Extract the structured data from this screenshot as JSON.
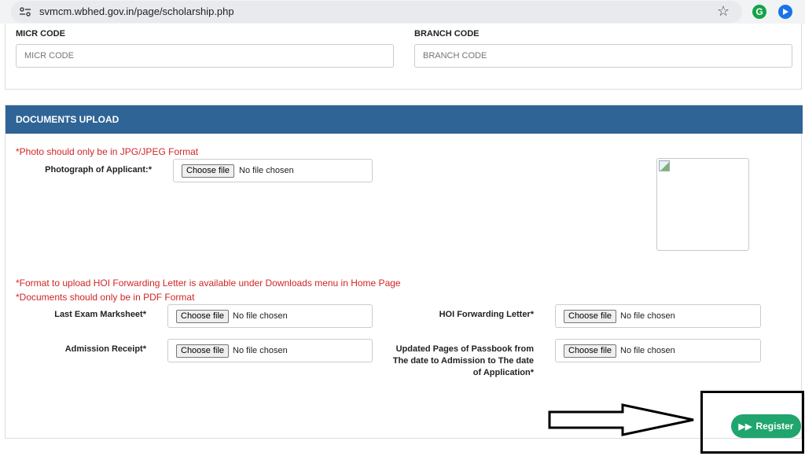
{
  "browser": {
    "url": "svmcm.wbhed.gov.in/page/scholarship.php",
    "extension_g_label": "G"
  },
  "bank": {
    "micr_label": "MICR CODE",
    "micr_placeholder": "MICR CODE",
    "branch_label": "BRANCH CODE",
    "branch_placeholder": "BRANCH CODE"
  },
  "documents": {
    "title": "DOCUMENTS UPLOAD",
    "photo_note": "*Photo should only be in JPG/JPEG Format",
    "photo_label": "Photograph of Applicant:*",
    "hoi_note": "*Format to upload HOI Forwarding Letter is available under Downloads menu in Home Page",
    "pdf_note": "*Documents should only be in PDF Format",
    "marksheet_label": "Last Exam Marksheet*",
    "hoi_label": "HOI Forwarding Letter*",
    "admission_label": "Admission Receipt*",
    "passbook_label": "Updated Pages of Passbook from The date to Admission to The date of Application*",
    "choose_file_label": "Choose file",
    "no_file_text": "No file chosen"
  },
  "register": {
    "label": "Register",
    "color": "#1fa56d"
  },
  "colors": {
    "header_bg": "#2f6496",
    "note_red": "#d02626"
  }
}
